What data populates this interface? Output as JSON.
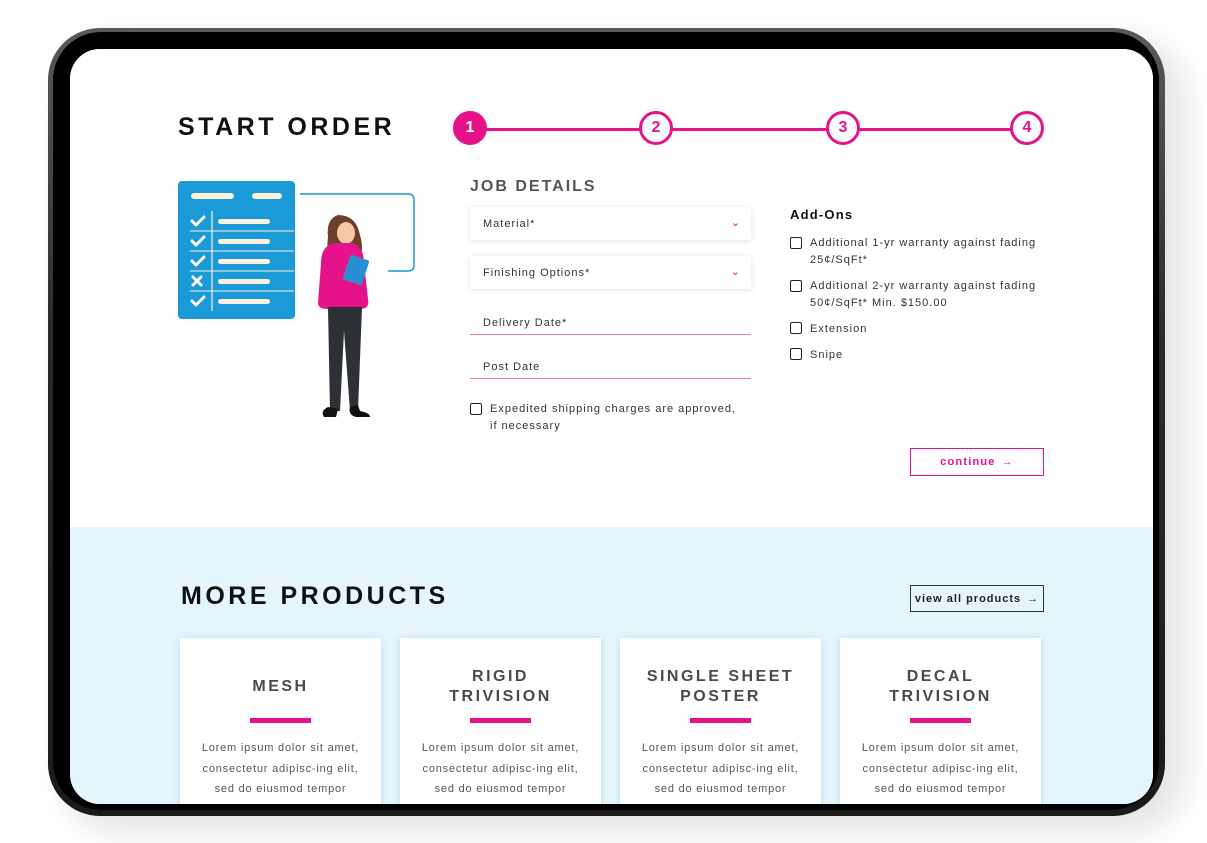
{
  "order": {
    "title": "START ORDER",
    "steps": [
      "1",
      "2",
      "3",
      "4"
    ],
    "active_step": 1,
    "job_details": {
      "heading": "JOB DETAILS",
      "material_label": "Material*",
      "finishing_label": "Finishing Options*",
      "delivery_date_placeholder": "Delivery Date*",
      "post_date_placeholder": "Post Date",
      "expedited_label_line1": "Expedited shipping charges are approved,",
      "expedited_label_line2": "if necessary",
      "expedited_checked": false
    },
    "addons": {
      "heading": "Add-Ons",
      "items": [
        {
          "line1": "Additional 1-yr warranty against fading",
          "line2": "25¢/SqFt*",
          "checked": false
        },
        {
          "line1": "Additional 2-yr warranty against fading",
          "line2": "50¢/SqFt* Min. $150.00",
          "checked": false
        },
        {
          "line1": "Extension",
          "line2": "",
          "checked": false
        },
        {
          "line1": "Snipe",
          "line2": "",
          "checked": false
        }
      ]
    },
    "continue_label": "continue",
    "continue_icon": "arrow-right-icon"
  },
  "products": {
    "title": "MORE PRODUCTS",
    "view_all_label": "view all products",
    "view_all_icon": "arrow-right-icon",
    "cards": [
      {
        "title_line1": "MESH",
        "title_line2": "",
        "text": "Lorem ipsum dolor sit amet, consectetur adipisc-ing elit, sed do eiusmod tempor incididunt ut"
      },
      {
        "title_line1": "RIGID",
        "title_line2": "TRIVISION",
        "text": "Lorem ipsum dolor sit amet, consectetur adipisc-ing elit, sed do eiusmod tempor incididunt ut"
      },
      {
        "title_line1": "SINGLE SHEET",
        "title_line2": "POSTER",
        "text": "Lorem ipsum dolor sit amet, consectetur adipisc-ing elit, sed do eiusmod tempor incididunt ut"
      },
      {
        "title_line1": "DECAL",
        "title_line2": "TRIVISION",
        "text": "Lorem ipsum dolor sit amet, consectetur adipisc-ing elit, sed do eiusmod tempor incididunt ut"
      }
    ]
  },
  "colors": {
    "accent": "#e5128a",
    "illustration_blue": "#1a9ad6",
    "products_bg": "#e4f5fc"
  }
}
